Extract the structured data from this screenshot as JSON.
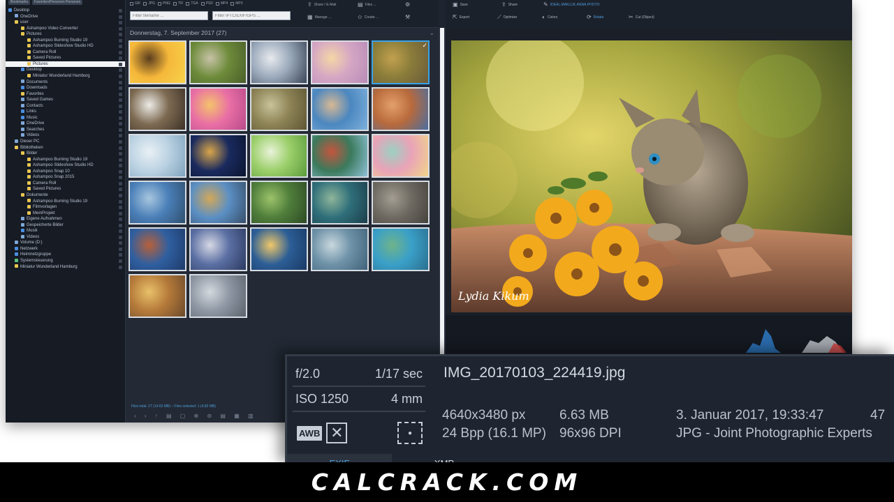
{
  "tree": {
    "top_pills": [
      "Bookmarks",
      "Favoriten/Personen Personen"
    ],
    "items": [
      {
        "label": "Desktop",
        "indent": 0,
        "icon": "blue"
      },
      {
        "label": "OneDrive",
        "indent": 1,
        "icon": "drive"
      },
      {
        "label": "user",
        "indent": 1,
        "icon": "folder"
      },
      {
        "label": "Ashampoo Video Converter",
        "indent": 2,
        "icon": "folder"
      },
      {
        "label": "Pictures",
        "indent": 2,
        "icon": "folder"
      },
      {
        "label": "Ashampoo Burning Studio 19",
        "indent": 3,
        "icon": "folder"
      },
      {
        "label": "Ashampoo Slideshow Studio HD",
        "indent": 3,
        "icon": "folder"
      },
      {
        "label": "Camera Roll",
        "indent": 3,
        "icon": "folder"
      },
      {
        "label": "Saved Pictures",
        "indent": 3,
        "icon": "folder"
      },
      {
        "label": "Pictures",
        "indent": 3,
        "icon": "folder",
        "selected": true
      },
      {
        "label": "Desktop",
        "indent": 2,
        "icon": "blue"
      },
      {
        "label": "Miniatur Wunderland Hamburg",
        "indent": 3,
        "icon": "folder"
      },
      {
        "label": "Documents",
        "indent": 2,
        "icon": "drive"
      },
      {
        "label": "Downloads",
        "indent": 2,
        "icon": "blue"
      },
      {
        "label": "Favorites",
        "indent": 2,
        "icon": "folder"
      },
      {
        "label": "Saved Games",
        "indent": 2,
        "icon": "drive"
      },
      {
        "label": "Contacts",
        "indent": 2,
        "icon": "drive"
      },
      {
        "label": "Links",
        "indent": 2,
        "icon": "blue"
      },
      {
        "label": "Music",
        "indent": 2,
        "icon": "blue"
      },
      {
        "label": "OneDrive",
        "indent": 2,
        "icon": "drive"
      },
      {
        "label": "Searches",
        "indent": 2,
        "icon": "drive"
      },
      {
        "label": "Videos",
        "indent": 2,
        "icon": "drive"
      },
      {
        "label": "Dieser PC",
        "indent": 1,
        "icon": "drive"
      },
      {
        "label": "Bibliotheken",
        "indent": 1,
        "icon": "folder"
      },
      {
        "label": "Bilder",
        "indent": 2,
        "icon": "folder"
      },
      {
        "label": "Ashampoo Burning Studio 19",
        "indent": 3,
        "icon": "folder"
      },
      {
        "label": "Ashampoo Slideshow Studio HD",
        "indent": 3,
        "icon": "folder"
      },
      {
        "label": "Ashampoo Snap 10",
        "indent": 3,
        "icon": "folder"
      },
      {
        "label": "Ashampoo Snap 2015",
        "indent": 3,
        "icon": "folder"
      },
      {
        "label": "Camera Roll",
        "indent": 3,
        "icon": "folder"
      },
      {
        "label": "Saved Pictures",
        "indent": 3,
        "icon": "folder"
      },
      {
        "label": "Dokumente",
        "indent": 2,
        "icon": "folder"
      },
      {
        "label": "Ashampoo Burning Studio 19",
        "indent": 3,
        "icon": "folder"
      },
      {
        "label": "Filmvorlagen",
        "indent": 3,
        "icon": "folder"
      },
      {
        "label": "MeinProjekt",
        "indent": 3,
        "icon": "folder"
      },
      {
        "label": "Eigene Aufnahmen",
        "indent": 2,
        "icon": "drive"
      },
      {
        "label": "Gespeicherte Bilder",
        "indent": 2,
        "icon": "drive"
      },
      {
        "label": "Musik",
        "indent": 2,
        "icon": "blue"
      },
      {
        "label": "Videos",
        "indent": 2,
        "icon": "drive"
      },
      {
        "label": "Volume (D:)",
        "indent": 1,
        "icon": "drive"
      },
      {
        "label": "Netzwerk",
        "indent": 1,
        "icon": "blue"
      },
      {
        "label": "Heimnetzgruppe",
        "indent": 1,
        "icon": "blue"
      },
      {
        "label": "Systemsteuerung",
        "indent": 1,
        "icon": "green"
      },
      {
        "label": "Miniatur Wunderland Hamburg",
        "indent": 1,
        "icon": "folder"
      }
    ]
  },
  "thumbs": {
    "formats": [
      "GIF",
      "JPG",
      "PNG",
      "TIF",
      "TGA",
      "PSD",
      "MP4",
      "MP3"
    ],
    "filter_name_placeholder": "Filter filename ...",
    "filter_iptc_placeholder": "Filter IPTC/EXIF/GPS ...",
    "toolbar": {
      "share": "Share / E-Mail",
      "files": "Files ...",
      "manage": "Manage ...",
      "create": "Create ..."
    },
    "date_header": "Donnerstag, 7. September 2017 (27)",
    "status": "Files total: 27 (14.63 MB) – Files selected: 1 (4.83 MB)",
    "nav": "‹ › ↑ ▤ ▢ ⊕ ⊖ ▤ ▦ ▥",
    "items": [
      {
        "name": "fruit",
        "c1": "#f5b73a",
        "c2": "#5a3d1e",
        "c3": "#f7d34b"
      },
      {
        "name": "cat-grass",
        "c1": "#6d8b3a",
        "c2": "#c7c2a6",
        "c3": "#4a5e2a"
      },
      {
        "name": "cat-white",
        "c1": "#9aa9bb",
        "c2": "#e8eaee",
        "c3": "#3b4658"
      },
      {
        "name": "flowers-pink",
        "c1": "#d5a7c4",
        "c2": "#f4d6a6",
        "c3": "#b88ab7"
      },
      {
        "name": "kitten-flowers",
        "c1": "#8a7d3a",
        "c2": "#c2a04e",
        "c3": "#6b5a3a",
        "selected": true
      },
      {
        "name": "cow",
        "c1": "#7d6a52",
        "c2": "#ecebe6",
        "c3": "#3d3126"
      },
      {
        "name": "macarons-pink",
        "c1": "#e96fa5",
        "c2": "#f4c36b",
        "c3": "#b84a8a"
      },
      {
        "name": "frog",
        "c1": "#8d8356",
        "c2": "#c8c29a",
        "c3": "#5e5634"
      },
      {
        "name": "city-canal",
        "c1": "#4b87c0",
        "c2": "#d7b894",
        "c3": "#7fb1db"
      },
      {
        "name": "canyon",
        "c1": "#b86a3c",
        "c2": "#e3a06a",
        "c3": "#4a6da0"
      },
      {
        "name": "sea-mist",
        "c1": "#bcd3e3",
        "c2": "#e9f0f4",
        "c3": "#7fa3bd"
      },
      {
        "name": "paris-night",
        "c1": "#1a2a5e",
        "c2": "#d9a64a",
        "c3": "#0b1530"
      },
      {
        "name": "grass",
        "c1": "#9bcf6a",
        "c2": "#e9f3d8",
        "c3": "#5c9b3c"
      },
      {
        "name": "coast-village",
        "c1": "#3b7a5c",
        "c2": "#c4553e",
        "c3": "#8fc1d8"
      },
      {
        "name": "macarons",
        "c1": "#e9a3b8",
        "c2": "#9bd0c2",
        "c3": "#f1d58a"
      },
      {
        "name": "skyline-lake",
        "c1": "#4a7fb8",
        "c2": "#a7c6de",
        "c3": "#2f4f6e"
      },
      {
        "name": "field-sky",
        "c1": "#5b8fc4",
        "c2": "#d3a85a",
        "c3": "#384f6a"
      },
      {
        "name": "lizard",
        "c1": "#4f7e3b",
        "c2": "#9cc36a",
        "c3": "#2e4a24"
      },
      {
        "name": "island-bay",
        "c1": "#2f6f7a",
        "c2": "#8fb59a",
        "c3": "#1b3e4a"
      },
      {
        "name": "stone-lion",
        "c1": "#6e6a62",
        "c2": "#a39d92",
        "c3": "#45423d"
      },
      {
        "name": "rock-coast",
        "c1": "#2f5fa0",
        "c2": "#b8603a",
        "c3": "#1f3b6a"
      },
      {
        "name": "fjord",
        "c1": "#5b6fa3",
        "c2": "#d6d8e4",
        "c3": "#2c3a60"
      },
      {
        "name": "sunset-sea",
        "c1": "#2c5e96",
        "c2": "#f0c86a",
        "c3": "#1a3a66"
      },
      {
        "name": "calm-lake",
        "c1": "#6e92a8",
        "c2": "#c9d8de",
        "c3": "#40627a"
      },
      {
        "name": "green-cliffs",
        "c1": "#3aa0c8",
        "c2": "#6fb38a",
        "c3": "#2b6f8f"
      },
      {
        "name": "autumn-forest",
        "c1": "#b57a3a",
        "c2": "#e8c06a",
        "c3": "#6b4a2a"
      },
      {
        "name": "statue",
        "c1": "#8e97a3",
        "c2": "#d4d9df",
        "c3": "#5b636e"
      }
    ]
  },
  "viewer": {
    "toolbar": {
      "save": "Save",
      "share": "Share",
      "edit_title": "IDEAL.MAKLUK.ANNA.PHOTO",
      "export": "Export",
      "optimize": "Optimize",
      "colors": "Colors",
      "rotate": "Rotate",
      "cut": "Cut (Object)"
    },
    "signature": "Lydia Kikum"
  },
  "overlay": {
    "aperture": "f/2.0",
    "shutter": "1/17 sec",
    "iso": "ISO 1250",
    "focal": "4 mm",
    "awb": "AWB",
    "flash_icon": "flash-off-icon",
    "frame_icon": "focus-frame-icon",
    "filename": "IMG_20170103_224419.jpg",
    "dimensions": "4640x3480 px",
    "size": "6.63 MB",
    "date": "3. Januar 2017, 19:33:47",
    "extra": "47",
    "bpp": "24 Bpp (16.1 MP)",
    "dpi": "96x96 DPI",
    "type": "JPG - Joint Photographic Experts",
    "tabs": [
      "EXIF",
      "XMP"
    ]
  },
  "footer": {
    "text": "CALCRACK.COM"
  }
}
